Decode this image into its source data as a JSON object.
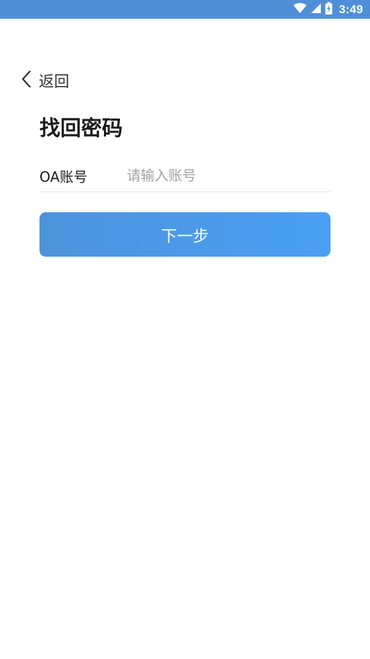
{
  "status_bar": {
    "time": "3:49",
    "icons": [
      "wifi-icon",
      "cell-signal-icon",
      "battery-charging-icon"
    ],
    "background": "#4f8fd8"
  },
  "nav": {
    "back_icon": "chevron-left-icon",
    "back_label": "返回"
  },
  "page": {
    "title": "找回密码"
  },
  "form": {
    "account_label": "OA账号",
    "account_value": "",
    "account_placeholder": "请输入账号"
  },
  "actions": {
    "next_label": "下一步",
    "button_color": "#4a9be8"
  }
}
